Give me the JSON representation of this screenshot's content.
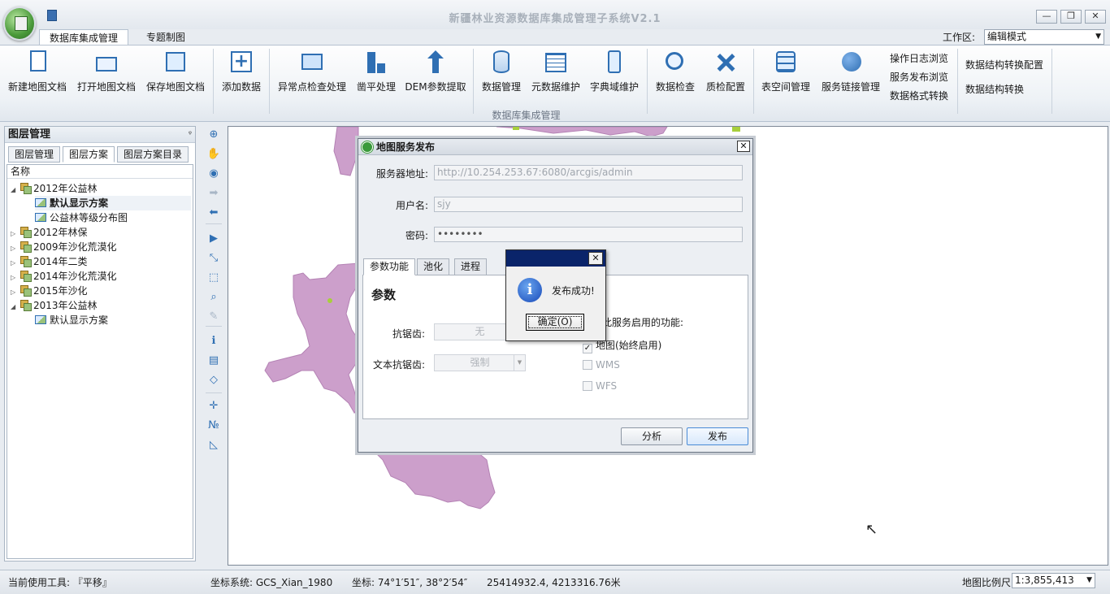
{
  "window": {
    "title": "新疆林业资源数据库集成管理子系统V2.1",
    "minimize": "—",
    "restore": "❐",
    "close": "✕"
  },
  "ribbon_tabs": [
    {
      "label": "数据库集成管理",
      "active": true
    },
    {
      "label": "专题制图",
      "active": false
    }
  ],
  "workspace": {
    "label": "工作区:",
    "value": "编辑模式"
  },
  "ribbon": {
    "group_label": "数据库集成管理",
    "buttons": [
      {
        "label": "新建地图文档",
        "icon": "new-document-icon"
      },
      {
        "label": "打开地图文档",
        "icon": "open-folder-icon"
      },
      {
        "label": "保存地图文档",
        "icon": "save-icon"
      },
      {
        "label": "添加数据",
        "icon": "add-data-icon"
      },
      {
        "label": "异常点检查处理",
        "icon": "anomaly-check-icon"
      },
      {
        "label": "凿平处理",
        "icon": "flatten-icon"
      },
      {
        "label": "DEM参数提取",
        "icon": "dem-extract-icon"
      },
      {
        "label": "数据管理",
        "icon": "database-icon"
      },
      {
        "label": "元数据维护",
        "icon": "metadata-icon"
      },
      {
        "label": "字典域维护",
        "icon": "dictionary-icon"
      },
      {
        "label": "数据检查",
        "icon": "data-check-icon"
      },
      {
        "label": "质检配置",
        "icon": "qc-config-icon"
      },
      {
        "label": "表空间管理",
        "icon": "tablespace-icon"
      },
      {
        "label": "服务链接管理",
        "icon": "service-link-icon"
      }
    ],
    "links": [
      {
        "label": "操作日志浏览"
      },
      {
        "label": "服务发布浏览"
      },
      {
        "label": "数据格式转换"
      },
      {
        "label": "数据结构转换配置"
      },
      {
        "label": "数据结构转换"
      }
    ]
  },
  "layer_panel": {
    "title": "图层管理",
    "pin": "ᵠ",
    "tabs": [
      {
        "label": "图层管理",
        "active": false
      },
      {
        "label": "图层方案",
        "active": true
      },
      {
        "label": "图层方案目录",
        "active": false
      }
    ],
    "column_header": "名称",
    "tree": [
      {
        "label": "2012年公益林",
        "level": 0,
        "expanded": true,
        "type": "group"
      },
      {
        "label": "默认显示方案",
        "level": 1,
        "type": "scheme",
        "selected": true
      },
      {
        "label": "公益林等级分布图",
        "level": 1,
        "type": "scheme"
      },
      {
        "label": "2012年林保",
        "level": 0,
        "expanded": false,
        "type": "group"
      },
      {
        "label": "2009年沙化荒漠化",
        "level": 0,
        "expanded": false,
        "type": "group"
      },
      {
        "label": "2014年二类",
        "level": 0,
        "expanded": false,
        "type": "group"
      },
      {
        "label": "2014年沙化荒漠化",
        "level": 0,
        "expanded": false,
        "type": "group"
      },
      {
        "label": "2015年沙化",
        "level": 0,
        "expanded": false,
        "type": "group"
      },
      {
        "label": "2013年公益林",
        "level": 0,
        "expanded": true,
        "type": "group"
      },
      {
        "label": "默认显示方案",
        "level": 1,
        "type": "scheme"
      }
    ]
  },
  "map_tools": [
    {
      "name": "zoom-in-icon",
      "glyph": "⊕",
      "enabled": true
    },
    {
      "name": "pan-hand-icon",
      "glyph": "✋",
      "enabled": true
    },
    {
      "name": "full-extent-globe-icon",
      "glyph": "◉",
      "enabled": true
    },
    {
      "name": "forward-arrow-icon",
      "glyph": "➡",
      "enabled": false
    },
    {
      "name": "back-arrow-icon",
      "glyph": "⬅",
      "enabled": true
    },
    {
      "name": "select-pointer-icon",
      "glyph": "▶",
      "enabled": true
    },
    {
      "name": "edit-vertex-icon",
      "glyph": "⤡",
      "enabled": true
    },
    {
      "name": "select-features-icon",
      "glyph": "⬚",
      "enabled": true
    },
    {
      "name": "find-icon",
      "glyph": "⌕",
      "enabled": true
    },
    {
      "name": "clear-brush-icon",
      "glyph": "✎",
      "enabled": false
    },
    {
      "name": "identify-info-icon",
      "glyph": "ℹ",
      "enabled": true
    },
    {
      "name": "attribute-table-icon",
      "glyph": "▤",
      "enabled": true
    },
    {
      "name": "eraser-icon",
      "glyph": "◇",
      "enabled": true
    },
    {
      "name": "coordinate-locate-icon",
      "glyph": "✛",
      "enabled": true
    },
    {
      "name": "number-locate-icon",
      "glyph": "№",
      "enabled": true
    },
    {
      "name": "measure-icon",
      "glyph": "◺",
      "enabled": true
    }
  ],
  "colors": {
    "region_fill": "#cc9fcb",
    "region_stroke": "#b482b4",
    "region_green": "#a8cf3c",
    "accent": "#2f6fb3"
  },
  "publish_dialog": {
    "title": "地图服务发布",
    "close": "✕",
    "server_label": "服务器地址:",
    "server_value": "http://10.254.253.67:6080/arcgis/admin",
    "user_label": "用户名:",
    "user_value": "sjy",
    "password_label": "密码:",
    "password_value": "••••••••",
    "tabs": [
      {
        "label": "参数功能",
        "active": true
      },
      {
        "label": "池化",
        "active": false
      },
      {
        "label": "进程",
        "active": false
      }
    ],
    "section_title": "参数",
    "antialias_label": "抗锯齿:",
    "antialias_value": "无",
    "text_antialias_label": "文本抗锯齿:",
    "text_antialias_value": "强制",
    "capabilities_label": "正对此服务启用的功能:",
    "capabilities": [
      {
        "label": "地图(始终启用)",
        "checked": true
      },
      {
        "label": "WMS",
        "checked": false
      },
      {
        "label": "WFS",
        "checked": false
      }
    ],
    "analyze_button": "分析",
    "publish_button": "发布"
  },
  "message_box": {
    "close": "✕",
    "icon": "i",
    "text": "发布成功!",
    "ok_button": "确定(O)"
  },
  "status_bar": {
    "tool": "当前使用工具: 『平移』",
    "crs": "坐标系统: GCS_Xian_1980",
    "coords_label": "坐标: 74°1′51″, 38°2′54″",
    "projected": "25414932.4, 4213316.76米",
    "scale_label": "地图比例尺",
    "scale_value": "1:3,855,413"
  }
}
